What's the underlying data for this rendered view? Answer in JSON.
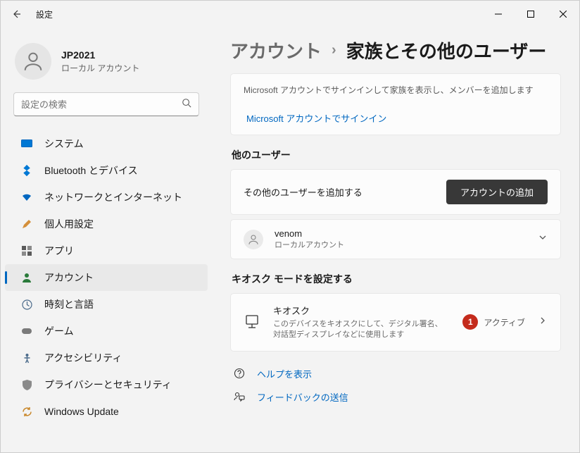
{
  "app": {
    "title": "設定"
  },
  "user": {
    "name": "JP2021",
    "role": "ローカル アカウント"
  },
  "search": {
    "placeholder": "設定の検索"
  },
  "nav": {
    "items": [
      {
        "label": "システム"
      },
      {
        "label": "Bluetooth とデバイス"
      },
      {
        "label": "ネットワークとインターネット"
      },
      {
        "label": "個人用設定"
      },
      {
        "label": "アプリ"
      },
      {
        "label": "アカウント"
      },
      {
        "label": "時刻と言語"
      },
      {
        "label": "ゲーム"
      },
      {
        "label": "アクセシビリティ"
      },
      {
        "label": "プライバシーとセキュリティ"
      },
      {
        "label": "Windows Update"
      }
    ]
  },
  "breadcrumb": {
    "parent": "アカウント",
    "current": "家族とその他のユーザー"
  },
  "family_card": {
    "desc": "Microsoft アカウントでサインインして家族を表示し、メンバーを追加します",
    "link": "Microsoft アカウントでサインイン"
  },
  "other_users": {
    "title": "他のユーザー",
    "add_label": "その他のユーザーを追加する",
    "add_button": "アカウントの追加",
    "users": [
      {
        "name": "venom",
        "role": "ローカルアカウント"
      }
    ]
  },
  "kiosk": {
    "section_title": "キオスク モードを設定する",
    "title": "キオスク",
    "desc": "このデバイスをキオスクにして、デジタル署名、対話型ディスプレイなどに使用します",
    "badge": "1",
    "status": "アクティブ"
  },
  "help": {
    "show_help": "ヘルプを表示",
    "feedback": "フィードバックの送信"
  }
}
